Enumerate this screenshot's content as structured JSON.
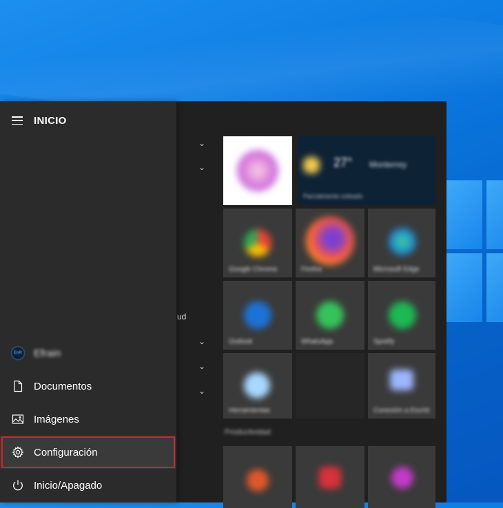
{
  "start_menu": {
    "header_title": "INICIO",
    "user_name": "Efrain",
    "avatar_text": "EnR",
    "items": [
      {
        "label": "Documentos",
        "icon": "document-icon"
      },
      {
        "label": "Imágenes",
        "icon": "image-icon"
      },
      {
        "label": "Configuración",
        "icon": "gear-icon",
        "highlighted": true
      },
      {
        "label": "Inicio/Apagado",
        "icon": "power-icon"
      }
    ]
  },
  "app_list": {
    "partial_text": "ud"
  },
  "tiles": {
    "weather_temp": "27°",
    "weather_city": "Monterrey",
    "weather_sub": "Parcialmente soleado",
    "captions": {
      "chrome": "Google Chrome",
      "firefox": "Firefox",
      "edge": "Microsoft Edge",
      "outlook": "Outlook",
      "whatsapp": "WhatsApp",
      "spotify": "Spotify",
      "tool": "Herramientas",
      "network": "Conexión a Escritorio"
    },
    "group_title": "Productividad"
  },
  "colors": {
    "highlight_border": "#d0222b",
    "menu_bg": "#2b2b2b",
    "desktop_blue": "#0a78e0"
  }
}
